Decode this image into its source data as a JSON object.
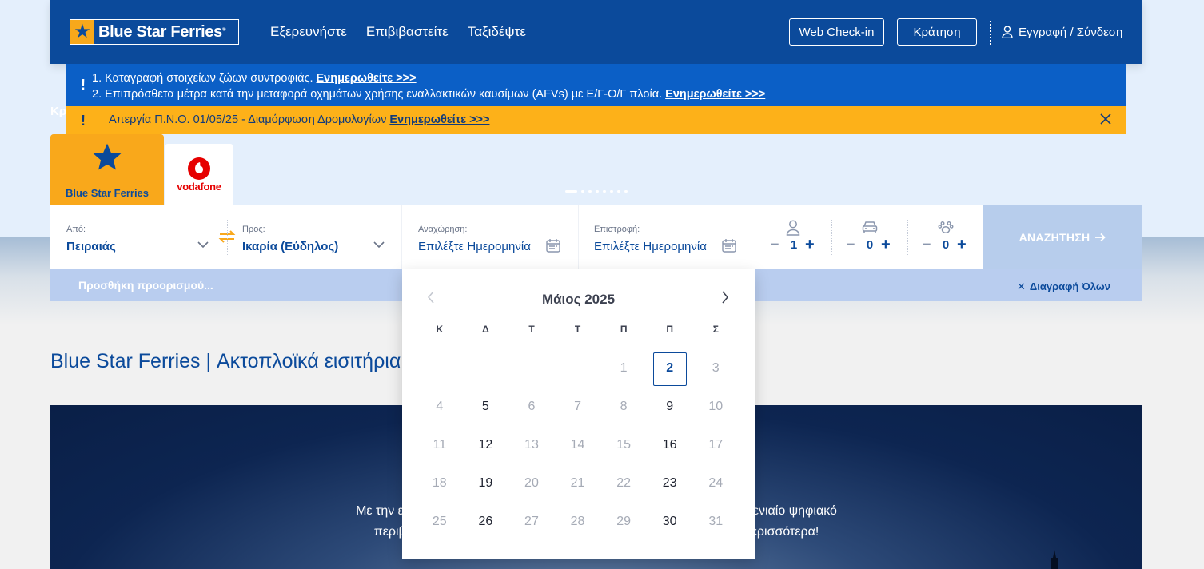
{
  "header": {
    "brand": "Blue Star Ferries",
    "nav": [
      "Εξερευνήστε",
      "Επιβιβαστείτε",
      "Ταξιδέψτε"
    ],
    "checkin_label": "Web Check-in",
    "booking_label": "Κράτηση",
    "login_label": "Εγγραφή / Σύνδεση"
  },
  "notices": {
    "line1_text": "1. Καταγραφή στοιχείων ζώων συντροφιάς.",
    "line1_link": "Ενημερωθείτε >>>",
    "line2_text": "2. Επιπρόσθετα μέτρα κατά την μεταφορά οχημάτων χρήσης εναλλακτικών καυσίμων (AFVs) με Ε/Γ-Ο/Γ πλοία.",
    "line2_link": "Ενημερωθείτε >>>",
    "alert_text": "Απεργία Π.Ν.Ο. 01/05/25 - Διαμόρφωση Δρομολογίων",
    "alert_link": "Ενημερωθείτε >>>",
    "hidden_text": "Κρ"
  },
  "partners": {
    "bsf_label": "Blue Star Ferries",
    "vodafone_label": "vodafone"
  },
  "search": {
    "from_label": "Από:",
    "from_value": "Πειραιάς",
    "to_label": "Προς:",
    "to_value": "Ικαρία (Εύδηλος)",
    "depart_label": "Αναχώρηση:",
    "depart_value": "Επιλέξτε Ημερομηνία",
    "return_label": "Επιστροφή:",
    "return_value": "Επιλέξτε Ημερομηνία",
    "passengers": "1",
    "vehicles": "0",
    "pets": "0",
    "search_label": "ΑΝΑΖΗΤΗΣΗ",
    "add_destination": "Προσθήκη προορισμού...",
    "clear_all": "Διαγραφή Όλων"
  },
  "calendar": {
    "month": "Μάιος 2025",
    "weekdays": [
      "Κ",
      "Δ",
      "Τ",
      "Τ",
      "Π",
      "Π",
      "Σ"
    ],
    "weeks": [
      [
        "",
        "",
        "",
        "",
        "1",
        "2",
        "3"
      ],
      [
        "4",
        "5",
        "6",
        "7",
        "8",
        "9",
        "10"
      ],
      [
        "11",
        "12",
        "13",
        "14",
        "15",
        "16",
        "17"
      ],
      [
        "18",
        "19",
        "20",
        "21",
        "22",
        "23",
        "24"
      ],
      [
        "25",
        "26",
        "27",
        "28",
        "29",
        "30",
        "31"
      ]
    ],
    "available": [
      "2",
      "5",
      "9",
      "12",
      "16",
      "19",
      "23",
      "26",
      "30"
    ],
    "selected": "2"
  },
  "page_title": "Blue Star Ferries | Ακτοπλοϊκά εισιτήρια",
  "promo": {
    "line1": "Με την εγγρα                                                                                    στο ενιαίο ψηφιακό",
    "line2": "περιβάλλο                                                                                    α περισσότερα!"
  },
  "colors": {
    "brand_blue": "#0b4a9b",
    "accent_orange": "#f9a81b",
    "notice_blue": "#0b5fc6",
    "notice_yellow": "#fdb119"
  }
}
